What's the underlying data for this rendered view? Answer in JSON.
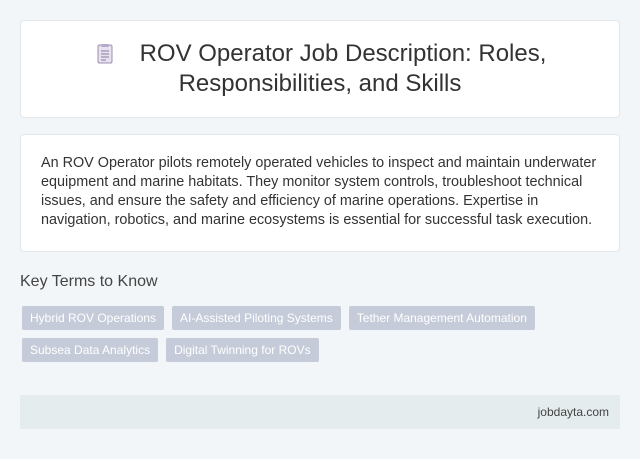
{
  "header": {
    "icon": "document-icon",
    "title_line1": "ROV Operator Job Description: Roles,",
    "title_line2": "Responsibilities, and Skills"
  },
  "description": "An ROV Operator pilots remotely operated vehicles to inspect and maintain underwater equipment and marine habitats. They monitor system controls, troubleshoot technical issues, and ensure the safety and efficiency of marine operations. Expertise in navigation, robotics, and marine ecosystems is essential for successful task execution.",
  "key_terms": {
    "heading": "Key Terms to Know",
    "tags": [
      "Hybrid ROV Operations",
      "AI-Assisted Piloting Systems",
      "Tether Management Automation",
      "Subsea Data Analytics",
      "Digital Twinning for ROVs"
    ]
  },
  "footer": {
    "site": "jobdayta.com"
  },
  "colors": {
    "background": "#f3f6f8",
    "tag_background": "#c5cbd9",
    "footer_background": "#e5ecee"
  }
}
